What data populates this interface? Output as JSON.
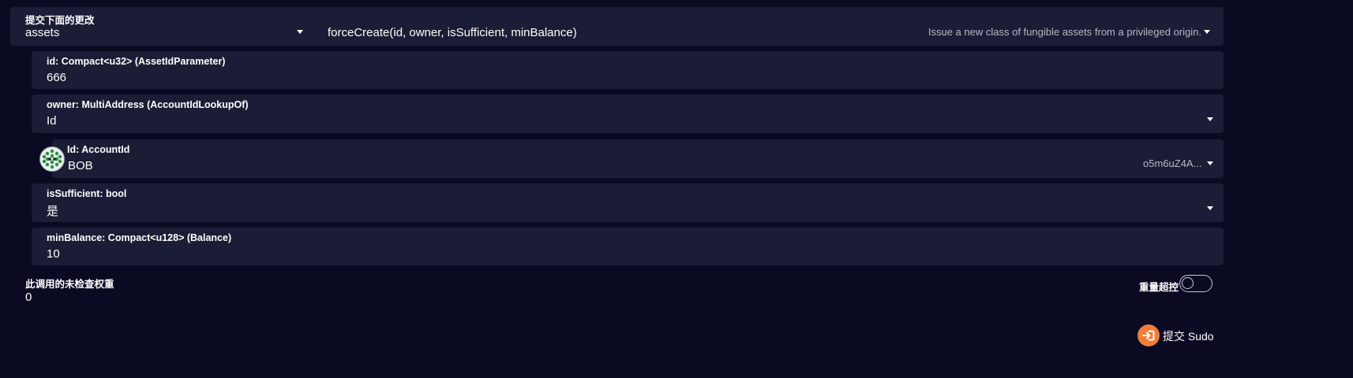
{
  "call": {
    "section_label": "提交下面的更改",
    "section_value": "assets",
    "method": "forceCreate(id, owner, isSufficient, minBalance)",
    "description": "Issue a new class of fungible assets from a privileged origin."
  },
  "params": {
    "id": {
      "label": "id: Compact<u32> (AssetIdParameter)",
      "value": "666"
    },
    "owner": {
      "label": "owner: MultiAddress (AccountIdLookupOf)",
      "value": "Id"
    },
    "account": {
      "label": "Id: AccountId",
      "value": "BOB",
      "address": "o5m6uZ4A..."
    },
    "isSufficient": {
      "label": "isSufficient: bool",
      "value": "是"
    },
    "minBalance": {
      "label": "minBalance: Compact<u128> (Balance)",
      "value": "10"
    }
  },
  "weight": {
    "label": "此调用的未检查权重",
    "value": "0",
    "override_label": "重量超控",
    "override_on": false
  },
  "submit": {
    "label": "提交 Sudo",
    "icon": "sign-in-icon",
    "icon_color": "#f07c3a"
  },
  "colors": {
    "background": "#0a0a23",
    "panel": "#1b1c35",
    "accent": "#f07c3a"
  }
}
